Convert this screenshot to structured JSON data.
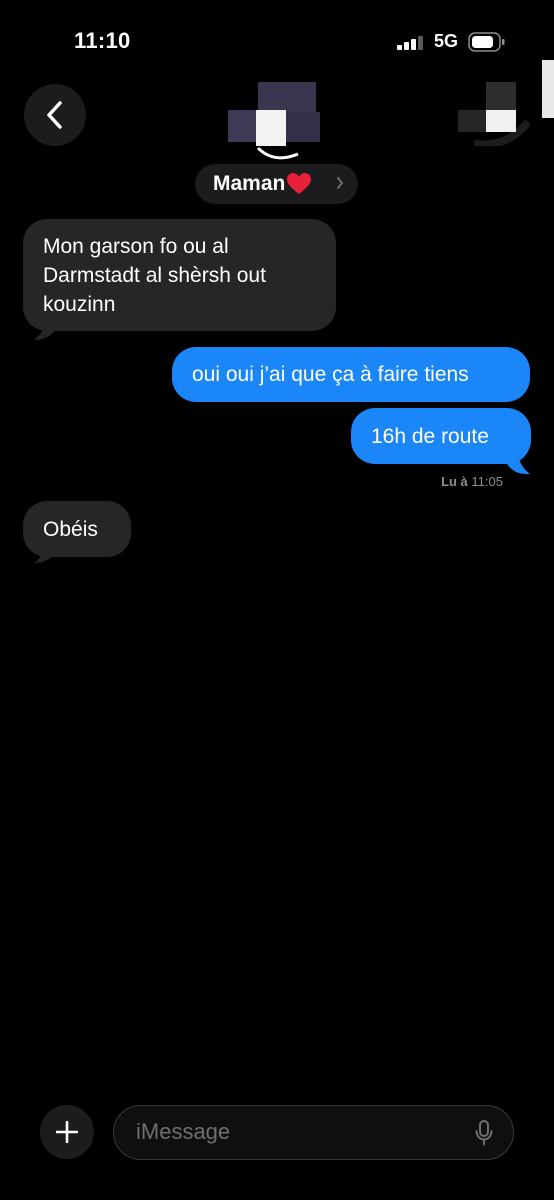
{
  "status_bar": {
    "time": "11:10",
    "network": "5G"
  },
  "header": {
    "contact_name": "Maman"
  },
  "messages": [
    {
      "direction": "received",
      "lines": [
        "Mon garson fo ou al",
        "Darmstadt al shèrsh out",
        "kouzinn"
      ]
    },
    {
      "direction": "sent",
      "text": "oui oui j’ai que ça à faire tiens"
    },
    {
      "direction": "sent",
      "text": "16h de route"
    },
    {
      "direction": "received",
      "text": "Obéis"
    }
  ],
  "read_receipt": {
    "label": "Lu à",
    "time": "11:05"
  },
  "composer": {
    "placeholder": "iMessage"
  },
  "colors": {
    "sent_bubble": "#1b86f8",
    "received_bubble": "#262628",
    "background": "#000000"
  },
  "icons": [
    "back-chevron-icon",
    "video-camera-icon",
    "plus-icon",
    "microphone-icon",
    "heart-icon",
    "signal-icon",
    "battery-icon"
  ]
}
